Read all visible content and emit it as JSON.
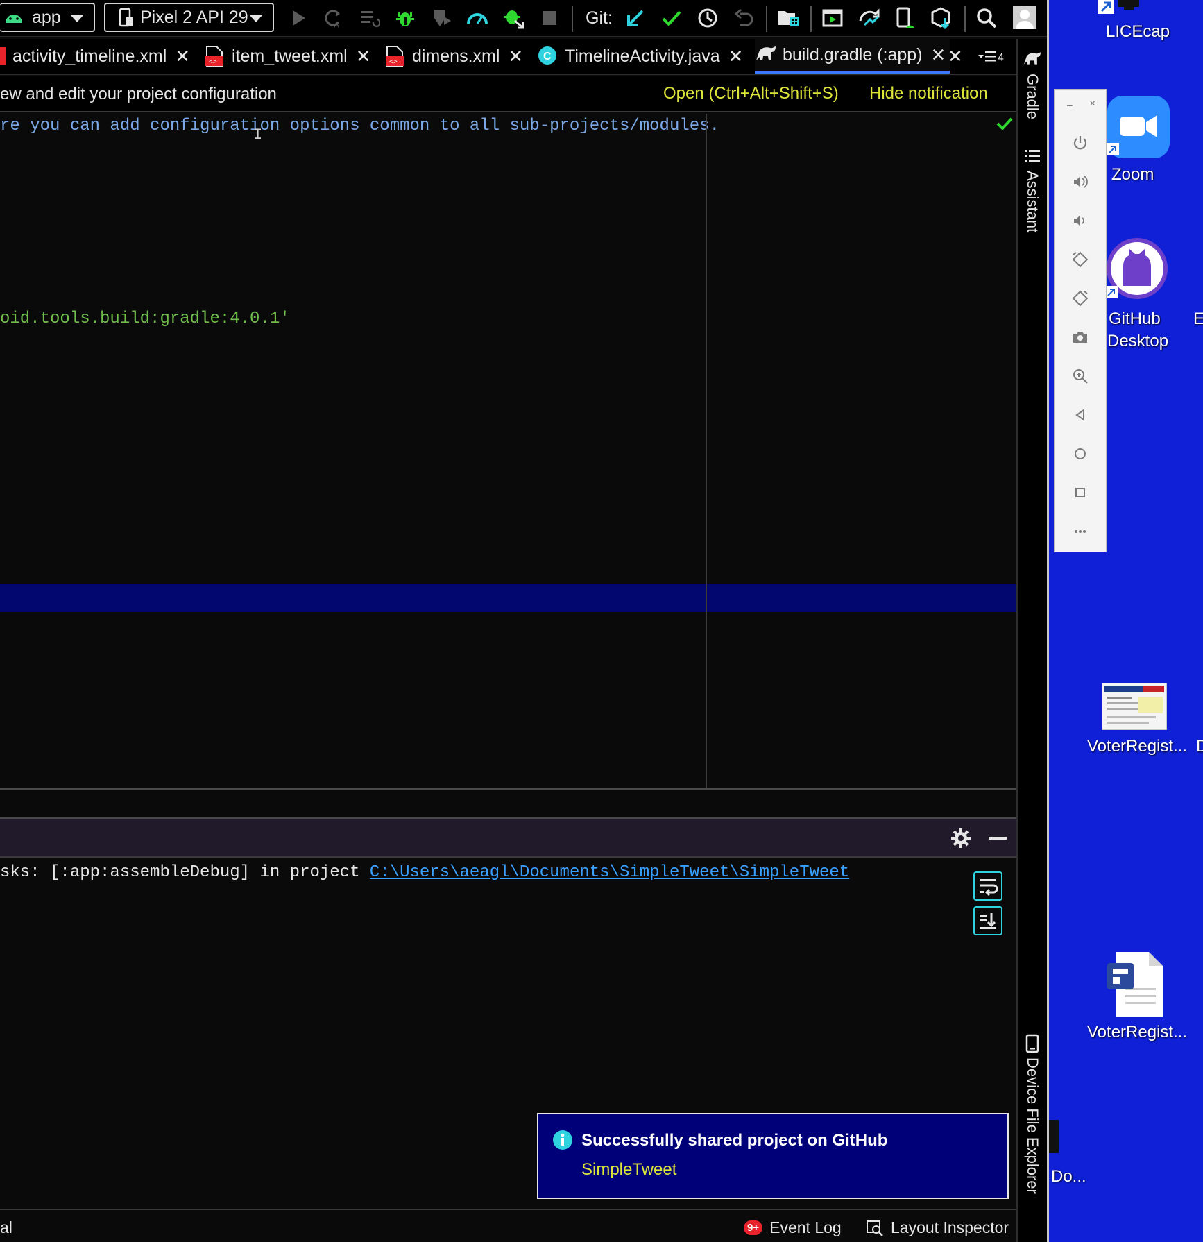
{
  "toolbar": {
    "config_label": "app",
    "device_label": "Pixel 2 API 29",
    "git_label": "Git:"
  },
  "tabs": [
    {
      "label": "activity_timeline.xml",
      "close": "✕"
    },
    {
      "label": "item_tweet.xml",
      "close": "✕"
    },
    {
      "label": "dimens.xml",
      "close": "✕"
    },
    {
      "label": "TimelineActivity.java",
      "close": "✕"
    },
    {
      "label": "build.gradle (:app)",
      "close": "✕"
    }
  ],
  "tabs_overflow_close": "✕",
  "tabs_overflow_count": "4",
  "notification": {
    "message": "ew and edit your project configuration",
    "open_link": "Open (Ctrl+Alt+Shift+S)",
    "hide_link": "Hide notification"
  },
  "editor": {
    "line1": "re you can add configuration options common to all sub-projects/modules.",
    "line2": "oid.tools.build:gradle:4.0.1'"
  },
  "console": {
    "text_prefix": "sks: [:app:assembleDebug] in project ",
    "path": "C:\\Users\\aeagl\\Documents\\SimpleTweet\\SimpleTweet"
  },
  "balloon": {
    "title": "Successfully shared project on GitHub",
    "project": "SimpleTweet"
  },
  "status": {
    "left_text": "al",
    "event_badge": "9+",
    "event_log": "Event Log",
    "layout_inspector": "Layout Inspector"
  },
  "toolstrip": {
    "gradle": "Gradle",
    "assistant": "Assistant",
    "device_file_explorer": "Device File Explorer"
  },
  "desktop": {
    "licecap": "LICEcap",
    "zoom": "Zoom",
    "github_line1": "GitHub",
    "github_line2": "Desktop",
    "ea_partial": "Ea",
    "voter1": "VoterRegist...",
    "d_partial": "D",
    "voter2": "VoterRegist...",
    "do_partial": "Do..."
  },
  "emulator": {
    "minimize": "–",
    "close": "×"
  },
  "colors": {
    "accent_yellow": "#dde53a",
    "link_blue": "#3aa0ff",
    "desktop_blue": "#0f20d6",
    "balloon_bg": "#000079",
    "highlight_line": "#02066f"
  }
}
